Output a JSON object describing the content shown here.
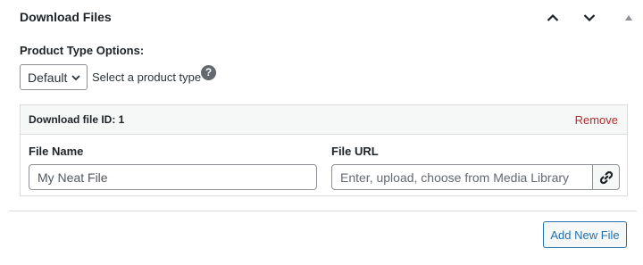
{
  "panel": {
    "title": "Download Files",
    "controls": {
      "move_up_icon": "chevron-up-icon",
      "move_down_icon": "chevron-down-icon",
      "toggle_icon": "triangle-up-icon"
    }
  },
  "product_type": {
    "label": "Product Type Options:",
    "select_value": "Default",
    "hint": "Select a product type",
    "help_glyph": "?"
  },
  "file": {
    "id_label": "Download file ID: 1",
    "remove_label": "Remove",
    "name_label": "File Name",
    "name_value": "My Neat File",
    "url_label": "File URL",
    "url_placeholder": "Enter, upload, choose from Media Library",
    "url_button_icon": "link-icon"
  },
  "add_button_label": "Add New File",
  "colors": {
    "accent": "#2271b1",
    "danger": "#b32d2e",
    "border": "#dcdcde"
  }
}
